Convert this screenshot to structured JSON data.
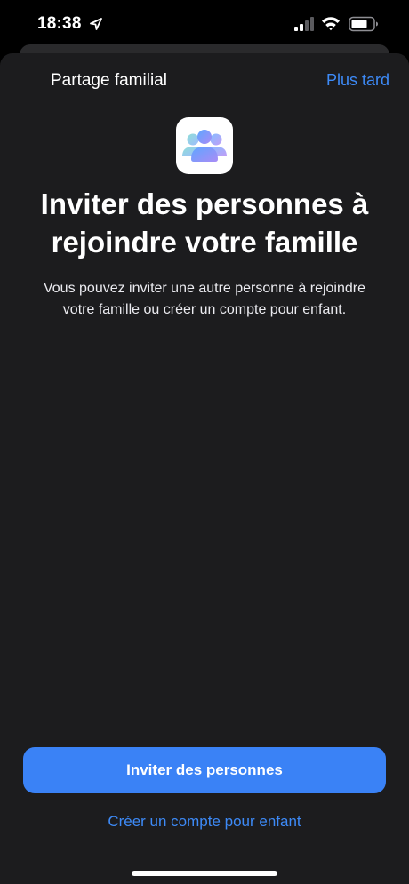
{
  "status_bar": {
    "time": "18:38",
    "icons": [
      "location-arrow-icon",
      "cellular-signal-icon",
      "wifi-icon",
      "battery-icon"
    ]
  },
  "nav": {
    "title": "Partage familial",
    "later": "Plus tard"
  },
  "main": {
    "app_icon": "family-sharing-icon",
    "headline": "Inviter des personnes à\nrejoindre votre famille",
    "description": "Vous pouvez inviter une autre personne à rejoindre\nvotre famille ou créer un compte pour enfant."
  },
  "actions": {
    "primary": "Inviter des personnes",
    "secondary": "Créer un compte pour enfant"
  },
  "colors": {
    "background": "#000000",
    "sheet": "#1c1c1e",
    "accent": "#3a82f6",
    "link": "#3d8af7"
  }
}
